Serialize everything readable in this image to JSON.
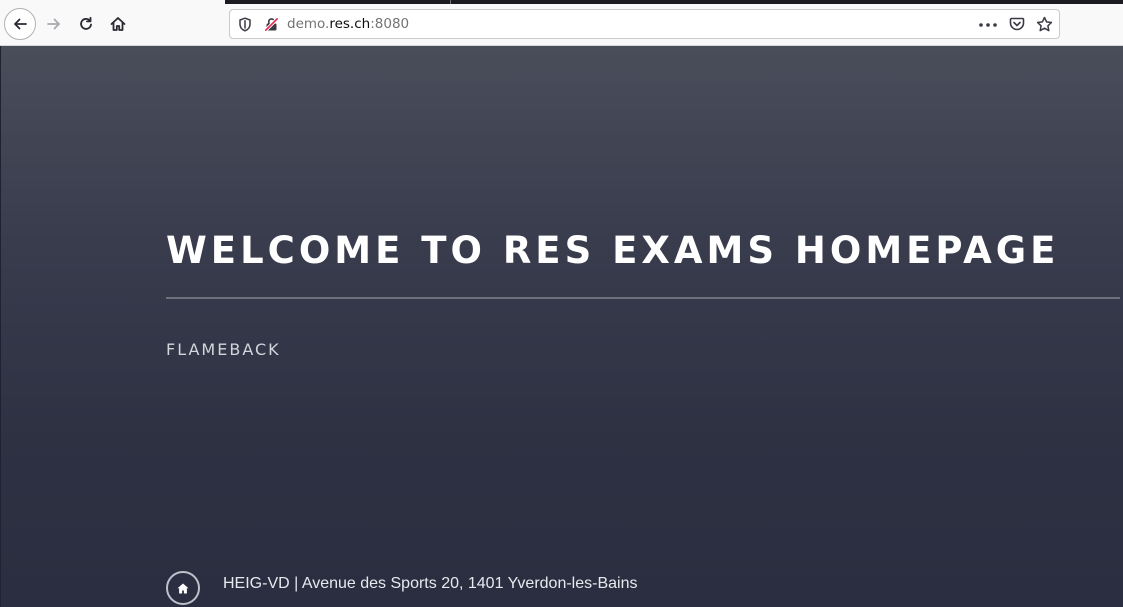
{
  "browser": {
    "url": {
      "prefix": "demo.",
      "host": "res.ch",
      "port": ":8080"
    },
    "icons": {
      "back": "back-arrow-icon",
      "forward": "forward-arrow-icon",
      "reload": "reload-icon",
      "home": "home-icon",
      "tracking": "shield-icon",
      "insecure": "insecure-lock-icon",
      "more": "more-dots-icon",
      "pocket": "pocket-icon",
      "bookmark": "star-icon"
    }
  },
  "page": {
    "heading": "WELCOME TO RES EXAMS HOMEPAGE",
    "subtitle": "FLAMEBACK",
    "footer": {
      "address": "HEIG-VD | Avenue des Sports 20, 1401 Yverdon-les-Bains",
      "home_icon": "home-icon"
    }
  },
  "colors": {
    "background_top": "#4a4d5a",
    "background_bottom": "#2a2e40",
    "heading": "#ffffff",
    "subtitle": "#d4d5dc"
  }
}
